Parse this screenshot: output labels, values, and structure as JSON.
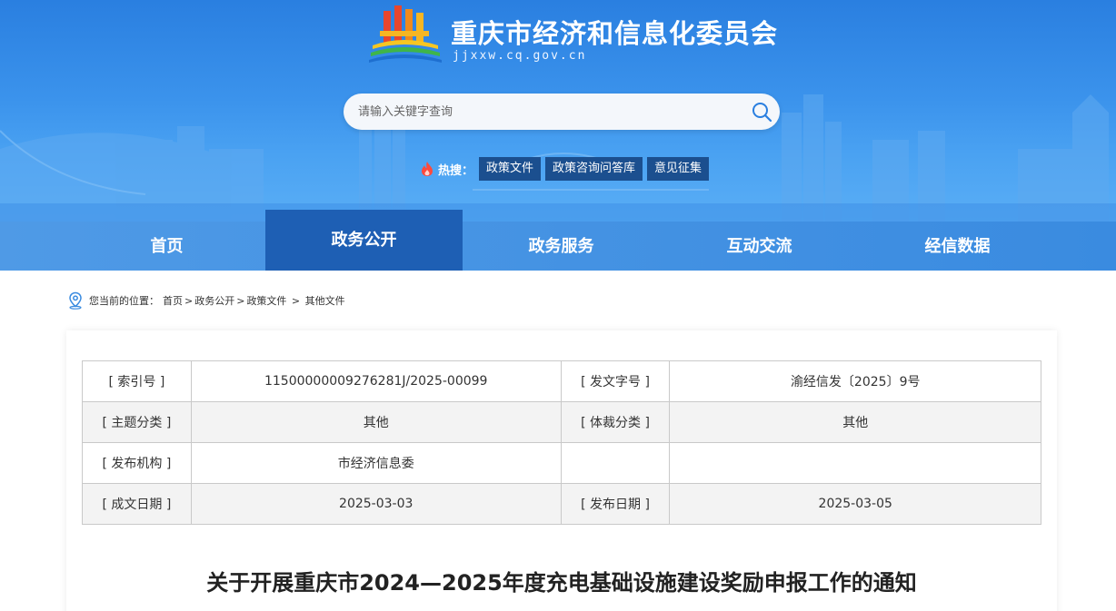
{
  "header": {
    "site_title": "重庆市经济和信息化委员会",
    "site_domain": "jjxxw.cq.gov.cn",
    "search_placeholder": "请输入关键字查询",
    "hot_label": "热搜：",
    "hot_tags": [
      "政策文件",
      "政策咨询问答库",
      "意见征集"
    ]
  },
  "nav": {
    "items": [
      "首页",
      "政务公开",
      "政务服务",
      "互动交流",
      "经信数据"
    ],
    "active_index": 1
  },
  "breadcrumb": {
    "prefix": "您当前的位置：",
    "items": [
      "首页",
      "政务公开",
      "政策文件",
      "其他文件"
    ],
    "separators": [
      ">",
      ">",
      " > "
    ]
  },
  "meta": {
    "rows": [
      [
        "[ 索引号 ]",
        "11500000009276281J/2025-00099",
        "[ 发文字号 ]",
        "渝经信发〔2025〕9号"
      ],
      [
        "[ 主题分类 ]",
        "其他",
        "[ 体裁分类 ]",
        "其他"
      ],
      [
        "[ 发布机构 ]",
        "市经济信息委",
        "",
        ""
      ],
      [
        "[ 成文日期 ]",
        "2025-03-03",
        "[ 发布日期 ]",
        "2025-03-05"
      ]
    ]
  },
  "document": {
    "title": "关于开展重庆市2024—2025年度充电基础设施建设奖励申报工作的通知"
  },
  "colors": {
    "banner_top": "#2a7fe0",
    "nav_active": "#1e5fb4",
    "hot_tag_bg": "#1b4f8f"
  }
}
